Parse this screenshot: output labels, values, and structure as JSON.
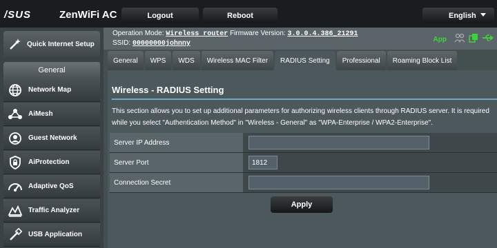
{
  "header": {
    "logo": "/SUS",
    "product": "ZenWiFi AC",
    "logout_label": "Logout",
    "reboot_label": "Reboot",
    "language": "English"
  },
  "sidebar": {
    "quick_setup_label": "Quick Internet Setup",
    "general_label": "General",
    "items": [
      {
        "label": "Network Map",
        "icon": "globe-icon"
      },
      {
        "label": "AiMesh",
        "icon": "mesh-icon"
      },
      {
        "label": "Guest Network",
        "icon": "guest-network-icon"
      },
      {
        "label": "AiProtection",
        "icon": "lock-shield-icon"
      },
      {
        "label": "Adaptive QoS",
        "icon": "speedometer-icon"
      },
      {
        "label": "Traffic Analyzer",
        "icon": "traffic-icon"
      },
      {
        "label": "USB Application",
        "icon": "usb-icon"
      }
    ]
  },
  "status": {
    "op_mode_label": "Operation Mode:",
    "op_mode_value": "Wireless router",
    "firmware_label": "Firmware Version:",
    "firmware_value": "3.0.0.4.386_21291",
    "ssid_label": "SSID:",
    "ssid_value": "00000000johnny",
    "app_label": "App",
    "colors": {
      "app": "#3fd23f"
    }
  },
  "tabs": [
    {
      "label": "General",
      "active": false
    },
    {
      "label": "WPS",
      "active": false
    },
    {
      "label": "WDS",
      "active": false
    },
    {
      "label": "Wireless MAC Filter",
      "active": false
    },
    {
      "label": "RADIUS Setting",
      "active": true
    },
    {
      "label": "Professional",
      "active": false
    },
    {
      "label": "Roaming Block List",
      "active": false
    }
  ],
  "content": {
    "title": "Wireless - RADIUS Setting",
    "description": "This section allows you to set up additional parameters for authorizing wireless clients through RADIUS server. It is required while you select \"Authentication Method\" in \"Wireless - General\" as \"WPA-Enterprise / WPA2-Enterprise\".",
    "fields": {
      "server_ip_label": "Server IP Address",
      "server_ip_value": "",
      "server_port_label": "Server Port",
      "server_port_value": "1812",
      "secret_label": "Connection Secret",
      "secret_value": ""
    },
    "apply_label": "Apply"
  }
}
